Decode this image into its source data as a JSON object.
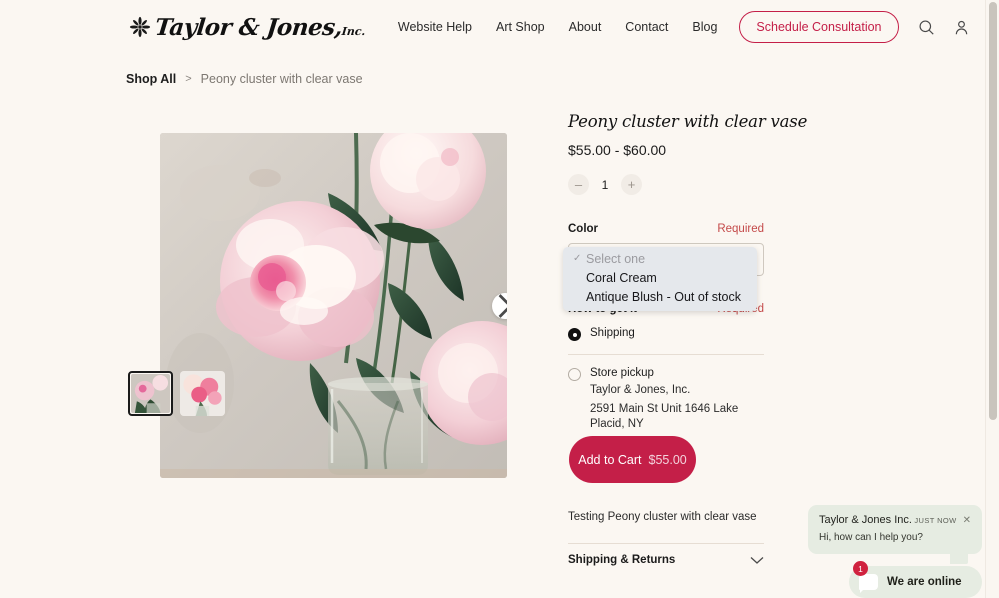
{
  "theme": {
    "page_bg": "#fbf7f2",
    "accent": "#c41f48",
    "required_color": "#c44a4a",
    "chat_bg": "#e6ece2",
    "badge_color": "#d0223f"
  },
  "header": {
    "logo_text": "Taylor & Jones,",
    "logo_suffix": "Inc.",
    "logo_icon": "flower-icon",
    "nav": [
      {
        "label": "Website Help"
      },
      {
        "label": "Art Shop"
      },
      {
        "label": "About"
      },
      {
        "label": "Contact"
      },
      {
        "label": "Blog"
      }
    ],
    "cta_label": "Schedule Consultation",
    "icons": [
      {
        "name": "search-icon"
      },
      {
        "name": "account-icon"
      },
      {
        "name": "cart-icon"
      }
    ]
  },
  "breadcrumb": {
    "parent": "Shop All",
    "separator": ">",
    "current": "Peony cluster with clear vase"
  },
  "gallery": {
    "next_arrow": "chevron-right-icon",
    "thumbnails": [
      {
        "name": "thumbnail-1",
        "selected": true
      },
      {
        "name": "thumbnail-2",
        "selected": false
      }
    ]
  },
  "product": {
    "title": "Peony cluster with clear vase",
    "price_range": "$55.00 - $60.00",
    "quantity": "1",
    "minus_label": "–",
    "plus_label": "+",
    "description": "Testing Peony cluster with clear vase",
    "color_field": {
      "label": "Color",
      "required_label": "Required",
      "selected_value": "Select one",
      "options": [
        {
          "label": "Select one",
          "checked": true,
          "disabled": true
        },
        {
          "label": "Coral Cream",
          "checked": false,
          "disabled": false
        },
        {
          "label": "Antique Blush - Out of stock",
          "checked": false,
          "disabled": true
        }
      ]
    },
    "fulfillment": {
      "label": "How to get it",
      "required_label": "Required",
      "options": [
        {
          "label": "Shipping",
          "selected": true
        },
        {
          "label": "Store pickup",
          "selected": false,
          "store_name": "Taylor & Jones, Inc.",
          "store_address": "2591 Main St Unit 1646 Lake Placid, NY"
        }
      ]
    },
    "add_to_cart": {
      "label": "Add to Cart",
      "amount": "$55.00"
    },
    "accordion": {
      "title": "Shipping & Returns",
      "icon": "chevron-down-icon",
      "expanded": false
    }
  },
  "chat": {
    "sender": "Taylor & Jones Inc.",
    "timestamp": "JUST NOW",
    "close_icon": "close-icon",
    "message": "Hi, how can I help you?",
    "pill_label": "We are online",
    "pill_icon": "chat-bubble-icon",
    "unread_count": "1"
  }
}
